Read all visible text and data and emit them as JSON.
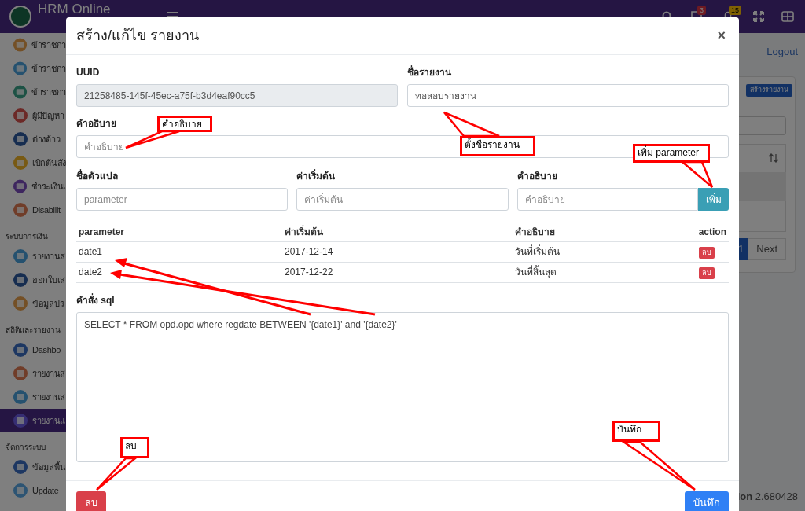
{
  "topbar": {
    "brand": "HRM Online",
    "badges": [
      "3",
      "15"
    ]
  },
  "sidebar": [
    {
      "kind": "item",
      "label": "ข้าราชกา",
      "selected": false
    },
    {
      "kind": "item",
      "label": "ข้าราชกา",
      "selected": false
    },
    {
      "kind": "item",
      "label": "ข้าราชกา",
      "selected": false
    },
    {
      "kind": "item",
      "label": "ผู้มีปัญหา",
      "selected": false
    },
    {
      "kind": "item",
      "label": "ต่างด้าว",
      "selected": false
    },
    {
      "kind": "item",
      "label": "เบิกต้นสัง",
      "selected": false
    },
    {
      "kind": "item",
      "label": "ชำระเงินเ",
      "selected": false
    },
    {
      "kind": "item",
      "label": "Disabilit",
      "selected": false
    },
    {
      "kind": "heading",
      "label": "ระบบการเงิน"
    },
    {
      "kind": "item",
      "label": "รายงานส",
      "selected": false
    },
    {
      "kind": "item",
      "label": "ออกใบเส",
      "selected": false
    },
    {
      "kind": "item",
      "label": "ข้อมูลปร",
      "selected": false
    },
    {
      "kind": "heading",
      "label": "สถิติและรายงาน"
    },
    {
      "kind": "item",
      "label": "Dashbo",
      "selected": false
    },
    {
      "kind": "item",
      "label": "รายงานส",
      "selected": false
    },
    {
      "kind": "item",
      "label": "รายงานส",
      "selected": false
    },
    {
      "kind": "item",
      "label": "รายงานแ",
      "selected": true
    },
    {
      "kind": "heading",
      "label": "จัดการระบบ"
    },
    {
      "kind": "item",
      "label": "ข้อมูลพื้น",
      "selected": false
    },
    {
      "kind": "item",
      "label": "Update",
      "selected": false
    }
  ],
  "page": {
    "logout": "Logout",
    "create_button": "สร้างรายงาน",
    "pagination": [
      {
        "label": "1",
        "selected": true
      },
      {
        "label": "Next",
        "selected": false
      }
    ],
    "version": "**ion** 2.680428"
  },
  "modal": {
    "title": "สร้าง/แก้ไข รายงาน",
    "close": "×",
    "uuid": {
      "label": "UUID",
      "value": "21258485-145f-45ec-a75f-b3d4eaf90cc5"
    },
    "name": {
      "label": "ชื่อรายงาน",
      "value": "ทอสอบรายงาน"
    },
    "description": {
      "label": "คำอธิบาย",
      "placeholder": "คำอธิบาย"
    },
    "param_fields": [
      {
        "label": "ชื่อตัวแปล",
        "placeholder": "parameter"
      },
      {
        "label": "ค่าเริ่มต้น",
        "placeholder": "ค่าเริ่มต้น"
      },
      {
        "label": "คำอธิบาย",
        "placeholder": "คำอธิบาย"
      }
    ],
    "add_button": "เพิ่ม",
    "table": {
      "columns": [
        "parameter",
        "ค่าเริ่มต้น",
        "คำอธิบาย",
        "action"
      ],
      "rows": [
        {
          "cells": [
            "date1",
            "2017-12-14",
            "วันที่เริ่มต้น"
          ],
          "action": "ลบ"
        },
        {
          "cells": [
            "date2",
            "2017-12-22",
            "วันที่สิ้นสุด"
          ],
          "action": "ลบ"
        }
      ]
    },
    "sql": {
      "label": "คำสั่ง sql",
      "value": "SELECT * FROM opd.opd where regdate BETWEEN '{date1}' and '{date2}'"
    },
    "delete_button": "ลบ",
    "save_button": "บันทึก"
  },
  "annotations": [
    {
      "text": "คำอธิบาย"
    },
    {
      "text": "ตั้งชื่อรายงาน"
    },
    {
      "text": "เพิ่ม parameter"
    },
    {
      "text": "บันทึก"
    },
    {
      "text": "ลบ"
    }
  ]
}
